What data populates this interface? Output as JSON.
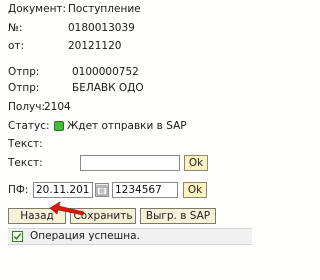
{
  "document": {
    "doc_label": "Документ:",
    "doc_value": "Поступление",
    "num_label": "№:",
    "num_value": "0180013039",
    "from_label": "от:",
    "from_value": "20121120"
  },
  "sender": {
    "label1": "Отпр:",
    "value1": "0100000752",
    "label2": "Отпр:",
    "value2": "БЕЛАВК ОДО"
  },
  "receiver": {
    "label": "Получ:",
    "value": "2104"
  },
  "status": {
    "label": "Статус:",
    "text": "Ждет отправки в SAP",
    "color": "#3fbf3a"
  },
  "text_fields": {
    "label1": "Текст:",
    "label2": "Текст:",
    "input_value": "",
    "ok_label": "Ok"
  },
  "pf": {
    "label": "ПФ:",
    "date_value": "20.11.2012",
    "code_value": "1234567",
    "ok_label": "Ok",
    "calendar_icon": "calendar-icon"
  },
  "actions": {
    "back_label": "Назад",
    "save_label": "Сохранить",
    "upload_label": "Выгр. в SAP"
  },
  "message": {
    "text": "Операция успешна.",
    "icon": "checkmark-icon",
    "icon_color": "#3b7a2a"
  }
}
